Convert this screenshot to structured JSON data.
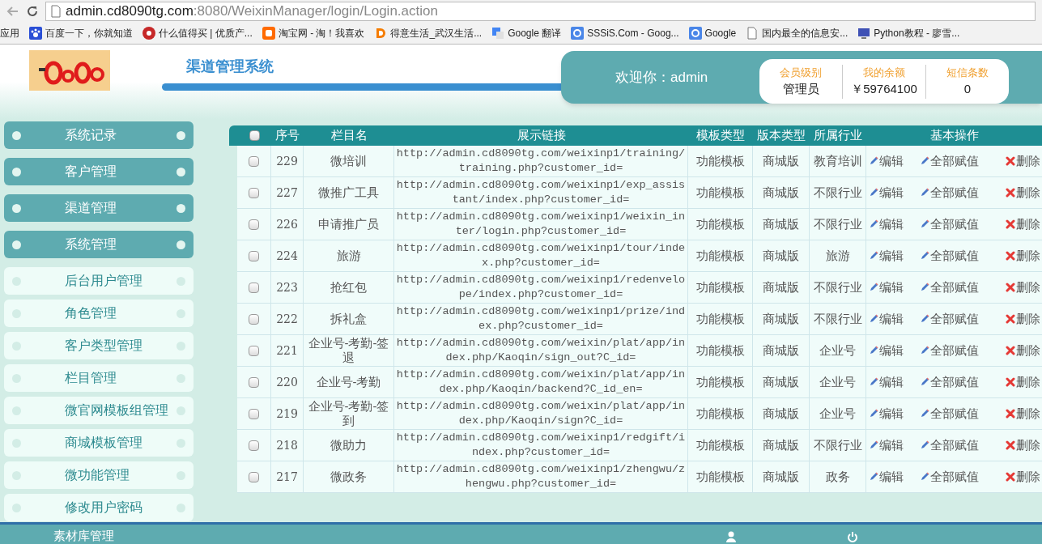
{
  "browser": {
    "url_host": "admin.cd8090tg.com",
    "url_rest": ":8080/WeixinManager/login/Login.action",
    "bookmarks": [
      {
        "label": "应用",
        "kind": "apps"
      },
      {
        "label": "百度一下，你就知道",
        "kind": "paw"
      },
      {
        "label": "什么值得买 | 优质产...",
        "kind": "round"
      },
      {
        "label": "淘宝网 - 淘！我喜欢",
        "kind": "tao"
      },
      {
        "label": "得意生活_武汉生活...",
        "kind": "d"
      },
      {
        "label": "Google 翻译",
        "kind": "translate"
      },
      {
        "label": "SSSiS.Com - Goog...",
        "kind": "g"
      },
      {
        "label": "Google",
        "kind": "g"
      },
      {
        "label": "国内最全的信息安...",
        "kind": "page"
      },
      {
        "label": "Python教程 - 廖雪...",
        "kind": "monitor"
      }
    ]
  },
  "header": {
    "title": "渠道管理系统",
    "welcome": "欢迎你：admin",
    "stats": [
      {
        "label": "会员级别",
        "value": "管理员"
      },
      {
        "label": "我的余额",
        "value": "￥59764100"
      },
      {
        "label": "短信条数",
        "value": "0"
      }
    ]
  },
  "sidebar": {
    "items": [
      {
        "label": "系统记录",
        "kind": "section"
      },
      {
        "label": "客户管理",
        "kind": "section"
      },
      {
        "label": "渠道管理",
        "kind": "section"
      },
      {
        "label": "系统管理",
        "kind": "section"
      },
      {
        "label": "后台用户管理",
        "kind": "sub"
      },
      {
        "label": "角色管理",
        "kind": "sub"
      },
      {
        "label": "客户类型管理",
        "kind": "sub"
      },
      {
        "label": "栏目管理",
        "kind": "sub"
      },
      {
        "label": "微官网模板组管理",
        "kind": "sub"
      },
      {
        "label": "商城模板管理",
        "kind": "sub"
      },
      {
        "label": "微功能管理",
        "kind": "sub"
      },
      {
        "label": "修改用户密码",
        "kind": "sub"
      }
    ]
  },
  "table": {
    "select_all_checked": false,
    "columns": [
      "序号",
      "栏目名",
      "展示链接",
      "模板类型",
      "版本类型",
      "所属行业",
      "基本操作"
    ],
    "rows": [
      {
        "checked": false,
        "id": "229",
        "name": "微培训",
        "link": "http://admin.cd8090tg.com/weixinp1/training/training.php?customer_id=",
        "template": "功能模板",
        "version": "商城版",
        "industry": "教育培训",
        "actions": [
          "编辑",
          "全部赋值",
          "删除"
        ]
      },
      {
        "checked": false,
        "id": "227",
        "name": "微推广工具",
        "link": "http://admin.cd8090tg.com/weixinp1/exp_assistant/index.php?customer_id=",
        "template": "功能模板",
        "version": "商城版",
        "industry": "不限行业",
        "actions": [
          "编辑",
          "全部赋值",
          "删除"
        ]
      },
      {
        "checked": false,
        "id": "226",
        "name": "申请推广员",
        "link": "http://admin.cd8090tg.com/weixinp1/weixin_inter/login.php?customer_id=",
        "template": "功能模板",
        "version": "商城版",
        "industry": "不限行业",
        "actions": [
          "编辑",
          "全部赋值",
          "删除"
        ]
      },
      {
        "checked": false,
        "id": "224",
        "name": "旅游",
        "link": "http://admin.cd8090tg.com/weixinp1/tour/index.php?customer_id=",
        "template": "功能模板",
        "version": "商城版",
        "industry": "旅游",
        "actions": [
          "编辑",
          "全部赋值",
          "删除"
        ]
      },
      {
        "checked": false,
        "id": "223",
        "name": "抢红包",
        "link": "http://admin.cd8090tg.com/weixinp1/redenvelope/index.php?customer_id=",
        "template": "功能模板",
        "version": "商城版",
        "industry": "不限行业",
        "actions": [
          "编辑",
          "全部赋值",
          "删除"
        ]
      },
      {
        "checked": false,
        "id": "222",
        "name": "拆礼盒",
        "link": "http://admin.cd8090tg.com/weixinp1/prize/index.php?customer_id=",
        "template": "功能模板",
        "version": "商城版",
        "industry": "不限行业",
        "actions": [
          "编辑",
          "全部赋值",
          "删除"
        ]
      },
      {
        "checked": false,
        "id": "221",
        "name": "企业号-考勤-签退",
        "link": "http://admin.cd8090tg.com/weixin/plat/app/index.php/Kaoqin/sign_out?C_id=",
        "template": "功能模板",
        "version": "商城版",
        "industry": "企业号",
        "actions": [
          "编辑",
          "全部赋值",
          "删除"
        ]
      },
      {
        "checked": false,
        "id": "220",
        "name": "企业号-考勤",
        "link": "http://admin.cd8090tg.com/weixin/plat/app/index.php/Kaoqin/backend?C_id_en=",
        "template": "功能模板",
        "version": "商城版",
        "industry": "企业号",
        "actions": [
          "编辑",
          "全部赋值",
          "删除"
        ]
      },
      {
        "checked": false,
        "id": "219",
        "name": "企业号-考勤-签到",
        "link": "http://admin.cd8090tg.com/weixin/plat/app/index.php/Kaoqin/sign?C_id=",
        "template": "功能模板",
        "version": "商城版",
        "industry": "企业号",
        "actions": [
          "编辑",
          "全部赋值",
          "删除"
        ]
      },
      {
        "checked": false,
        "id": "218",
        "name": "微助力",
        "link": "http://admin.cd8090tg.com/weixinp1/redgift/index.php?customer_id=",
        "template": "功能模板",
        "version": "商城版",
        "industry": "不限行业",
        "actions": [
          "编辑",
          "全部赋值",
          "删除"
        ]
      },
      {
        "checked": false,
        "id": "217",
        "name": "微政务",
        "link": "http://admin.cd8090tg.com/weixinp1/zhengwu/zhengwu.php?customer_id=",
        "template": "功能模板",
        "version": "商城版",
        "industry": "政务",
        "actions": [
          "编辑",
          "全部赋值",
          "删除"
        ]
      }
    ]
  },
  "footer": {
    "section": "素材库管理"
  }
}
